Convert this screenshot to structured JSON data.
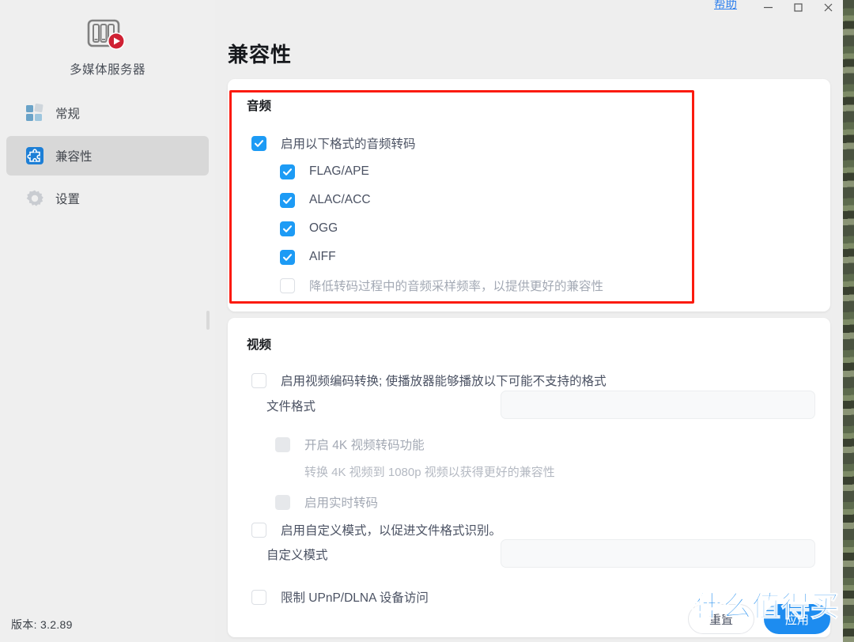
{
  "window": {
    "help_label": "帮助",
    "minimize_icon": "minimize-icon",
    "maximize_icon": "maximize-icon",
    "close_icon": "close-icon"
  },
  "sidebar": {
    "app_icon": "nas-media-server-icon",
    "app_title": "多媒体服务器",
    "items": [
      {
        "label": "常规",
        "icon": "general-tiles-icon",
        "active": false
      },
      {
        "label": "兼容性",
        "icon": "puzzle-compatibility-icon",
        "active": true
      },
      {
        "label": "设置",
        "icon": "gear-settings-icon",
        "active": false
      }
    ],
    "version": "版本: 3.2.89"
  },
  "page": {
    "title": "兼容性"
  },
  "audio": {
    "title": "音频",
    "enable_transcode": {
      "label": "启用以下格式的音频转码",
      "checked": true
    },
    "formats": [
      {
        "label": "FLAG/APE",
        "checked": true
      },
      {
        "label": "ALAC/ACC",
        "checked": true
      },
      {
        "label": "OGG",
        "checked": true
      },
      {
        "label": "AIFF",
        "checked": true
      }
    ],
    "lower_sample_rate": {
      "label": "降低转码过程中的音频采样频率，以提供更好的兼容性",
      "checked": false
    },
    "highlight_color": "#fb1a0e"
  },
  "video": {
    "title": "视频",
    "enable_video_transcode": {
      "label": "启用视频编码转换; 使播放器能够播放以下可能不支持的格式",
      "checked": false
    },
    "file_format": {
      "label": "文件格式",
      "value": "",
      "placeholder": ""
    },
    "enable_4k": {
      "label": "开启 4K 视频转码功能",
      "checked": false,
      "disabled": true
    },
    "hint_4k": "转换 4K 视频到 1080p 视频以获得更好的兼容性",
    "realtime_transcode": {
      "label": "启用实时转码",
      "checked": false,
      "disabled": true
    },
    "enable_custom_mode": {
      "label": "启用自定义模式，以促进文件格式识别。",
      "checked": false
    },
    "custom_mode": {
      "label": "自定义模式",
      "value": "",
      "placeholder": ""
    },
    "restrict_upnp": {
      "label": "限制 UPnP/DLNA 设备访问",
      "checked": false
    }
  },
  "footer": {
    "reset_label": "重置",
    "apply_label": "应用"
  },
  "watermark": {
    "text": "什么值得买",
    "badge": "值"
  }
}
